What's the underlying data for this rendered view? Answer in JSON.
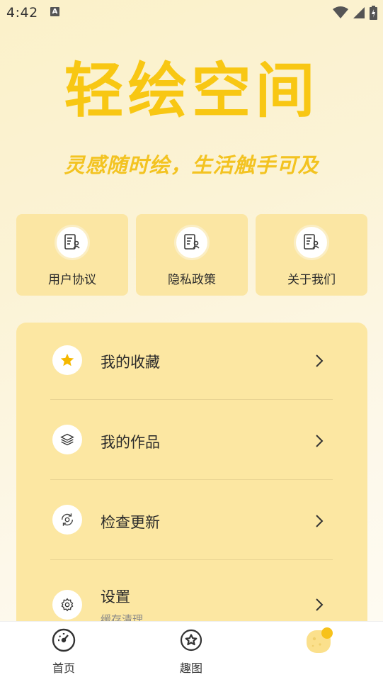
{
  "status_bar": {
    "time": "4:42",
    "notification_icon_letter": "A",
    "icons": [
      "wifi-icon",
      "signal-icon",
      "battery-icon"
    ]
  },
  "hero": {
    "title": "轻绘空间",
    "subtitle": "灵感随时绘，生活触手可及",
    "accent_color": "#f8c713"
  },
  "quick_links": [
    {
      "label": "用户协议",
      "icon": "document-user-icon"
    },
    {
      "label": "隐私政策",
      "icon": "document-user-icon"
    },
    {
      "label": "关于我们",
      "icon": "document-user-icon"
    }
  ],
  "menu": {
    "items": [
      {
        "label": "我的收藏",
        "icon": "star-icon"
      },
      {
        "label": "我的作品",
        "icon": "layers-icon"
      },
      {
        "label": "检查更新",
        "icon": "refresh-icon"
      },
      {
        "label": "设置",
        "sub": "缓存清理",
        "icon": "gear-icon"
      }
    ],
    "card_color": "#fce7a2"
  },
  "bottom_nav": {
    "items": [
      {
        "label": "首页",
        "icon": "dashboard-icon"
      },
      {
        "label": "趣图",
        "icon": "star-circle-icon"
      },
      {
        "label": "",
        "icon": "profile-avatar-icon"
      }
    ]
  }
}
